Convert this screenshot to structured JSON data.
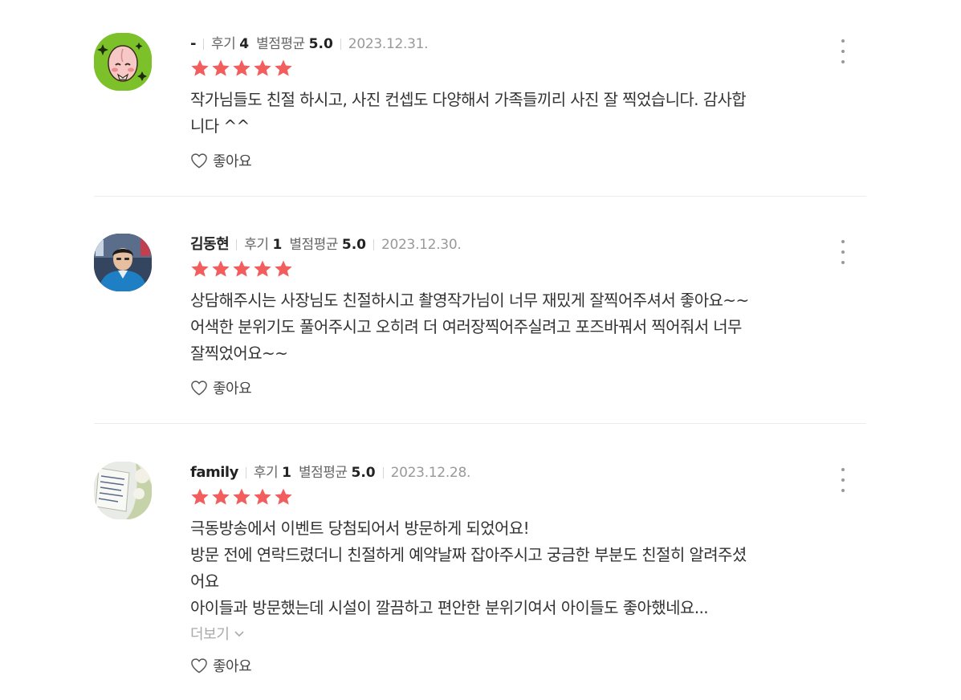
{
  "reviews": [
    {
      "author": "-",
      "review_label": "후기",
      "review_count": "4",
      "rating_label": "별점평균",
      "rating_avg": "5.0",
      "date": "2023.12.31.",
      "stars": 5,
      "text_lines": [
        "작가님들도 친절 하시고, 사진 컨셉도 다양해서 가족들끼리 사진 잘 찍었습니다. 감사합",
        "니다 ^^"
      ],
      "like_label": "좋아요",
      "avatar_icon": "peach-character-avatar"
    },
    {
      "author": "김동현",
      "review_label": "후기",
      "review_count": "1",
      "rating_label": "별점평균",
      "rating_avg": "5.0",
      "date": "2023.12.30.",
      "stars": 5,
      "text_lines": [
        "상담해주시는 사장님도 친절하시고 촬영작가님이 너무 재밌게 잘찍어주셔서 좋아요~~",
        "어색한 분위기도 풀어주시고 오히려 더 여러장찍어주실려고 포즈바꿔서 찍어줘서 너무",
        "잘찍었어요~~"
      ],
      "like_label": "좋아요",
      "avatar_icon": "person-photo-avatar"
    },
    {
      "author": "family",
      "review_label": "후기",
      "review_count": "1",
      "rating_label": "별점평균",
      "rating_avg": "5.0",
      "date": "2023.12.28.",
      "stars": 5,
      "text_lines": [
        "극동방송에서 이벤트 당첨되어서 방문하게 되었어요!",
        "방문 전에 연락드렸더니 친절하게 예약날짜 잡아주시고 궁금한 부분도 친절히 알려주셨",
        "어요",
        "아이들과 방문했는데 시설이 깔끔하고 편안한 분위기여서 아이들도 좋아했네요..."
      ],
      "more_label": "더보기",
      "like_label": "좋아요",
      "avatar_icon": "note-photo-avatar"
    }
  ],
  "colors": {
    "star": "#f25d5d",
    "divider": "#ececec",
    "muted": "#999999"
  },
  "icons": {
    "star": "star-icon",
    "like": "heart-outline-icon",
    "menu": "more-vertical-icon",
    "more": "chevron-down-icon"
  }
}
